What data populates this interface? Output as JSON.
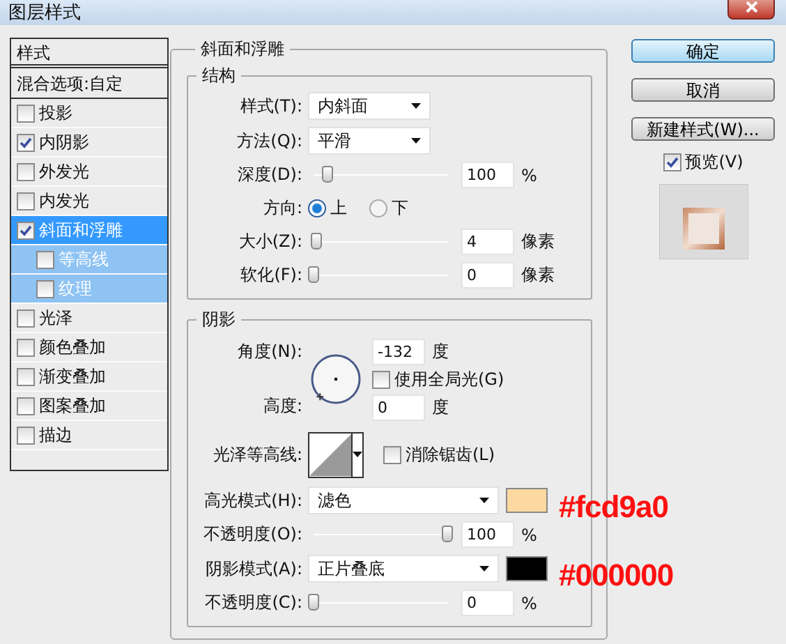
{
  "window": {
    "title": "图层样式"
  },
  "styles_panel": {
    "header": "样式",
    "blend_options": "混合选项:自定",
    "items": [
      {
        "label": "投影",
        "checked": false,
        "selected": false
      },
      {
        "label": "内阴影",
        "checked": true,
        "selected": false
      },
      {
        "label": "外发光",
        "checked": false,
        "selected": false
      },
      {
        "label": "内发光",
        "checked": false,
        "selected": false
      },
      {
        "label": "斜面和浮雕",
        "checked": true,
        "selected": true,
        "children": [
          {
            "label": "等高线",
            "checked": false,
            "selected": false
          },
          {
            "label": "纹理",
            "checked": false,
            "selected": false
          }
        ]
      },
      {
        "label": "光泽",
        "checked": false,
        "selected": false
      },
      {
        "label": "颜色叠加",
        "checked": false,
        "selected": false
      },
      {
        "label": "渐变叠加",
        "checked": false,
        "selected": false
      },
      {
        "label": "图案叠加",
        "checked": false,
        "selected": false
      },
      {
        "label": "描边",
        "checked": false,
        "selected": false
      }
    ]
  },
  "bevel": {
    "title": "斜面和浮雕",
    "structure": {
      "title": "结构",
      "style": {
        "label": "样式(T):",
        "value": "内斜面"
      },
      "technique": {
        "label": "方法(Q):",
        "value": "平滑"
      },
      "depth": {
        "label": "深度(D):",
        "level": 0.1,
        "value": "100",
        "unit": "%"
      },
      "direction": {
        "label": "方向:",
        "options": [
          {
            "label": "上",
            "selected": true
          },
          {
            "label": "下",
            "selected": false
          }
        ]
      },
      "size": {
        "label": "大小(Z):",
        "level": 0.02,
        "value": "4",
        "unit": "像素"
      },
      "soften": {
        "label": "软化(F):",
        "level": 0,
        "value": "0",
        "unit": "像素"
      }
    },
    "shading": {
      "title": "阴影",
      "angle": {
        "label": "角度(N):",
        "value": "-132",
        "unit": "度"
      },
      "global_light": {
        "label": "使用全局光(G)",
        "checked": false
      },
      "altitude": {
        "label": "高度:",
        "value": "0",
        "unit": "度"
      },
      "gloss_contour": {
        "label": "光泽等高线:"
      },
      "anti_alias": {
        "label": "消除锯齿(L)",
        "checked": false
      },
      "highlight_mode": {
        "label": "高光模式(H):",
        "value": "滤色",
        "color": "#fcd9a0",
        "annotation": "#fcd9a0"
      },
      "highlight_opacity": {
        "label": "不透明度(O):",
        "level": 1,
        "value": "100",
        "unit": "%"
      },
      "shadow_mode": {
        "label": "阴影模式(A):",
        "value": "正片叠底",
        "color": "#000000",
        "annotation": "#000000"
      },
      "shadow_opacity": {
        "label": "不透明度(C):",
        "level": 0,
        "value": "0",
        "unit": "%"
      }
    }
  },
  "buttons": [
    {
      "label": "确定",
      "default": true
    },
    {
      "label": "取消",
      "default": false
    },
    {
      "label": "新建样式(W)...",
      "default": false
    }
  ],
  "preview": {
    "label": "预览(V)",
    "checked": true
  }
}
